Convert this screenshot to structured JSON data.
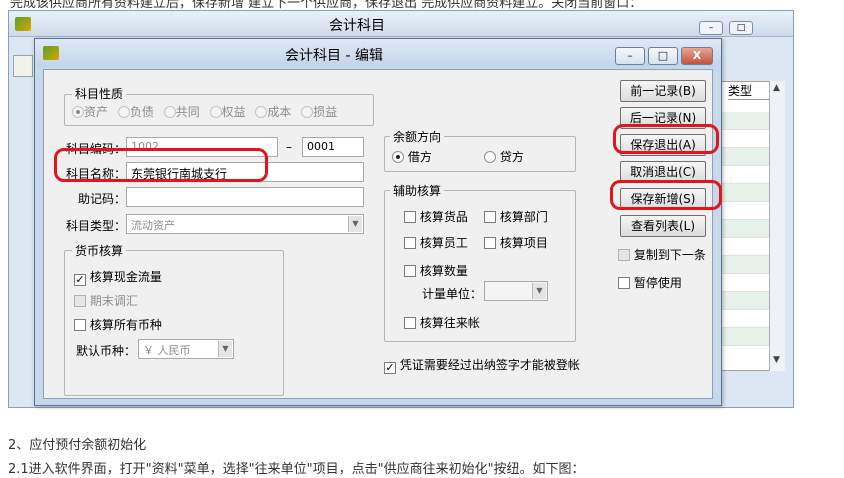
{
  "doc": {
    "top_line": "完成该供应商所有资料建立后，保存新增 建立下一个供应商，保存退出 完成供应商资料建立。关闭当前窗口：",
    "section_title": "2、应付预付余额初始化",
    "step_text": "2.1进入软件界面，打开\"资料\"菜单，选择\"往来单位\"项目，点击\"供应商往来初始化\"按纽。如下图："
  },
  "bg_window": {
    "title": "会计科目",
    "btn_min": "–",
    "btn_max": "□",
    "table_header": "类型"
  },
  "dialog": {
    "title": "会计科目 - 编辑",
    "btn_min": "–",
    "btn_max": "□",
    "btn_close": "X",
    "nature": {
      "label": "科目性质",
      "options": [
        "资产",
        "负债",
        "共同",
        "权益",
        "成本",
        "损益"
      ],
      "selected": "资产"
    },
    "code": {
      "label": "科目编码：",
      "prefix": "1002",
      "dash": "–",
      "suffix": "0001"
    },
    "name": {
      "label": "科目名称：",
      "value": "东莞银行南城支行"
    },
    "mnemonic": {
      "label": "助记码：",
      "value": ""
    },
    "type": {
      "label": "科目类型：",
      "value": "流动资产"
    },
    "currency": {
      "label": "货币核算",
      "cash_flow": "核算现金流量",
      "period_adjust": "期末调汇",
      "all_currency": "核算所有币种",
      "default_label": "默认币种：",
      "default_value": "￥ 人民币"
    },
    "balance": {
      "label": "余额方向",
      "debit": "借方",
      "credit": "贷方",
      "selected": "借方"
    },
    "aux": {
      "label": "辅助核算",
      "goods": "核算货品",
      "dept": "核算部门",
      "staff": "核算员工",
      "project": "核算项目",
      "qty": "核算数量",
      "unit_label": "计量单位：",
      "dealings": "核算往来帐"
    },
    "voucher_check": "凭证需要经过出纳签字才能被登帐",
    "buttons": {
      "prev": "前一记录(B)",
      "next": "后一记录(N)",
      "save_exit": "保存退出(A)",
      "cancel_exit": "取消退出(C)",
      "save_new": "保存新增(S)",
      "view_list": "查看列表(L)"
    },
    "copy_next": "复制到下一条",
    "pause_use": "暂停使用"
  }
}
